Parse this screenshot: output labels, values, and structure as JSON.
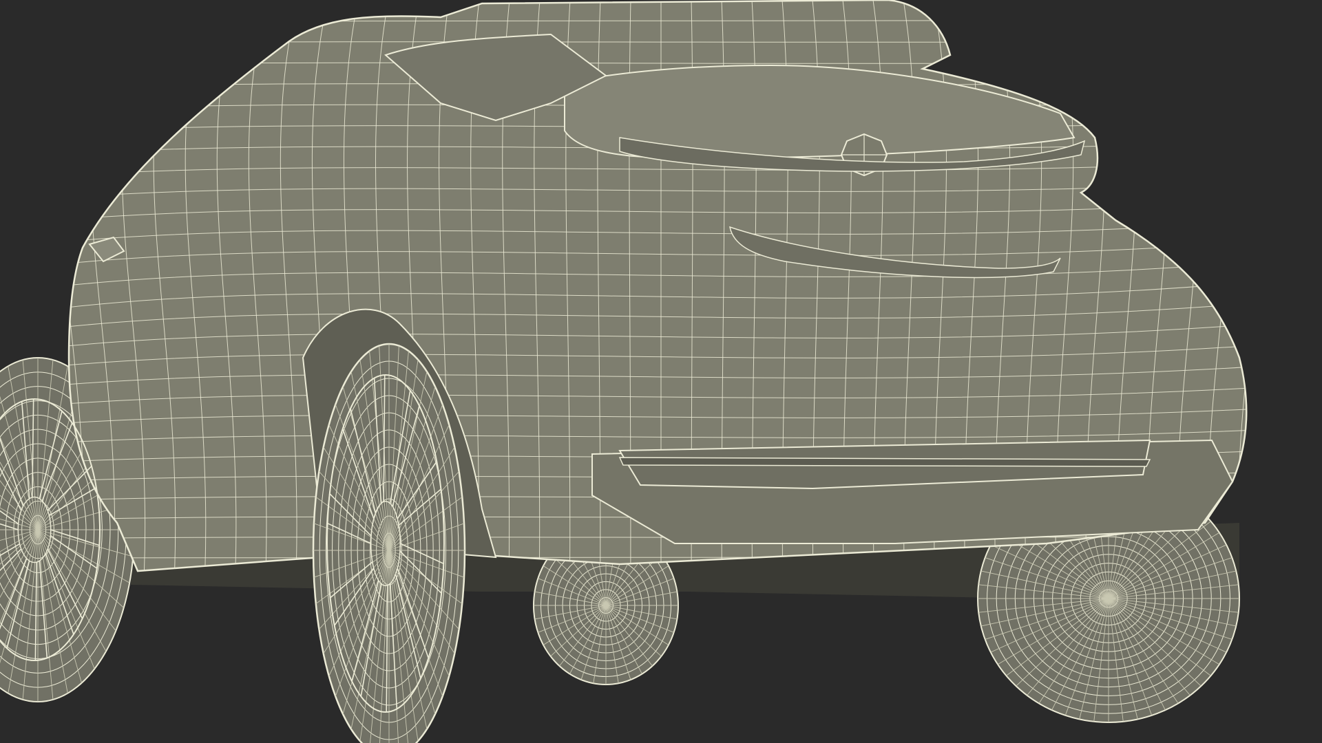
{
  "scene": {
    "subject": "wireframe-car-rear-view",
    "colors": {
      "background": "#2a2a2a",
      "body_fill": "#7e7e6f",
      "body_shadow": "#5f5f54",
      "body_highlight": "#8d8d7e",
      "tire_fill": "#717165",
      "undercarriage": "#3a3a34",
      "wire": "#ecebd6",
      "wire_dim": "#c9c8b2"
    },
    "display_mode": "shaded-wireframe"
  }
}
